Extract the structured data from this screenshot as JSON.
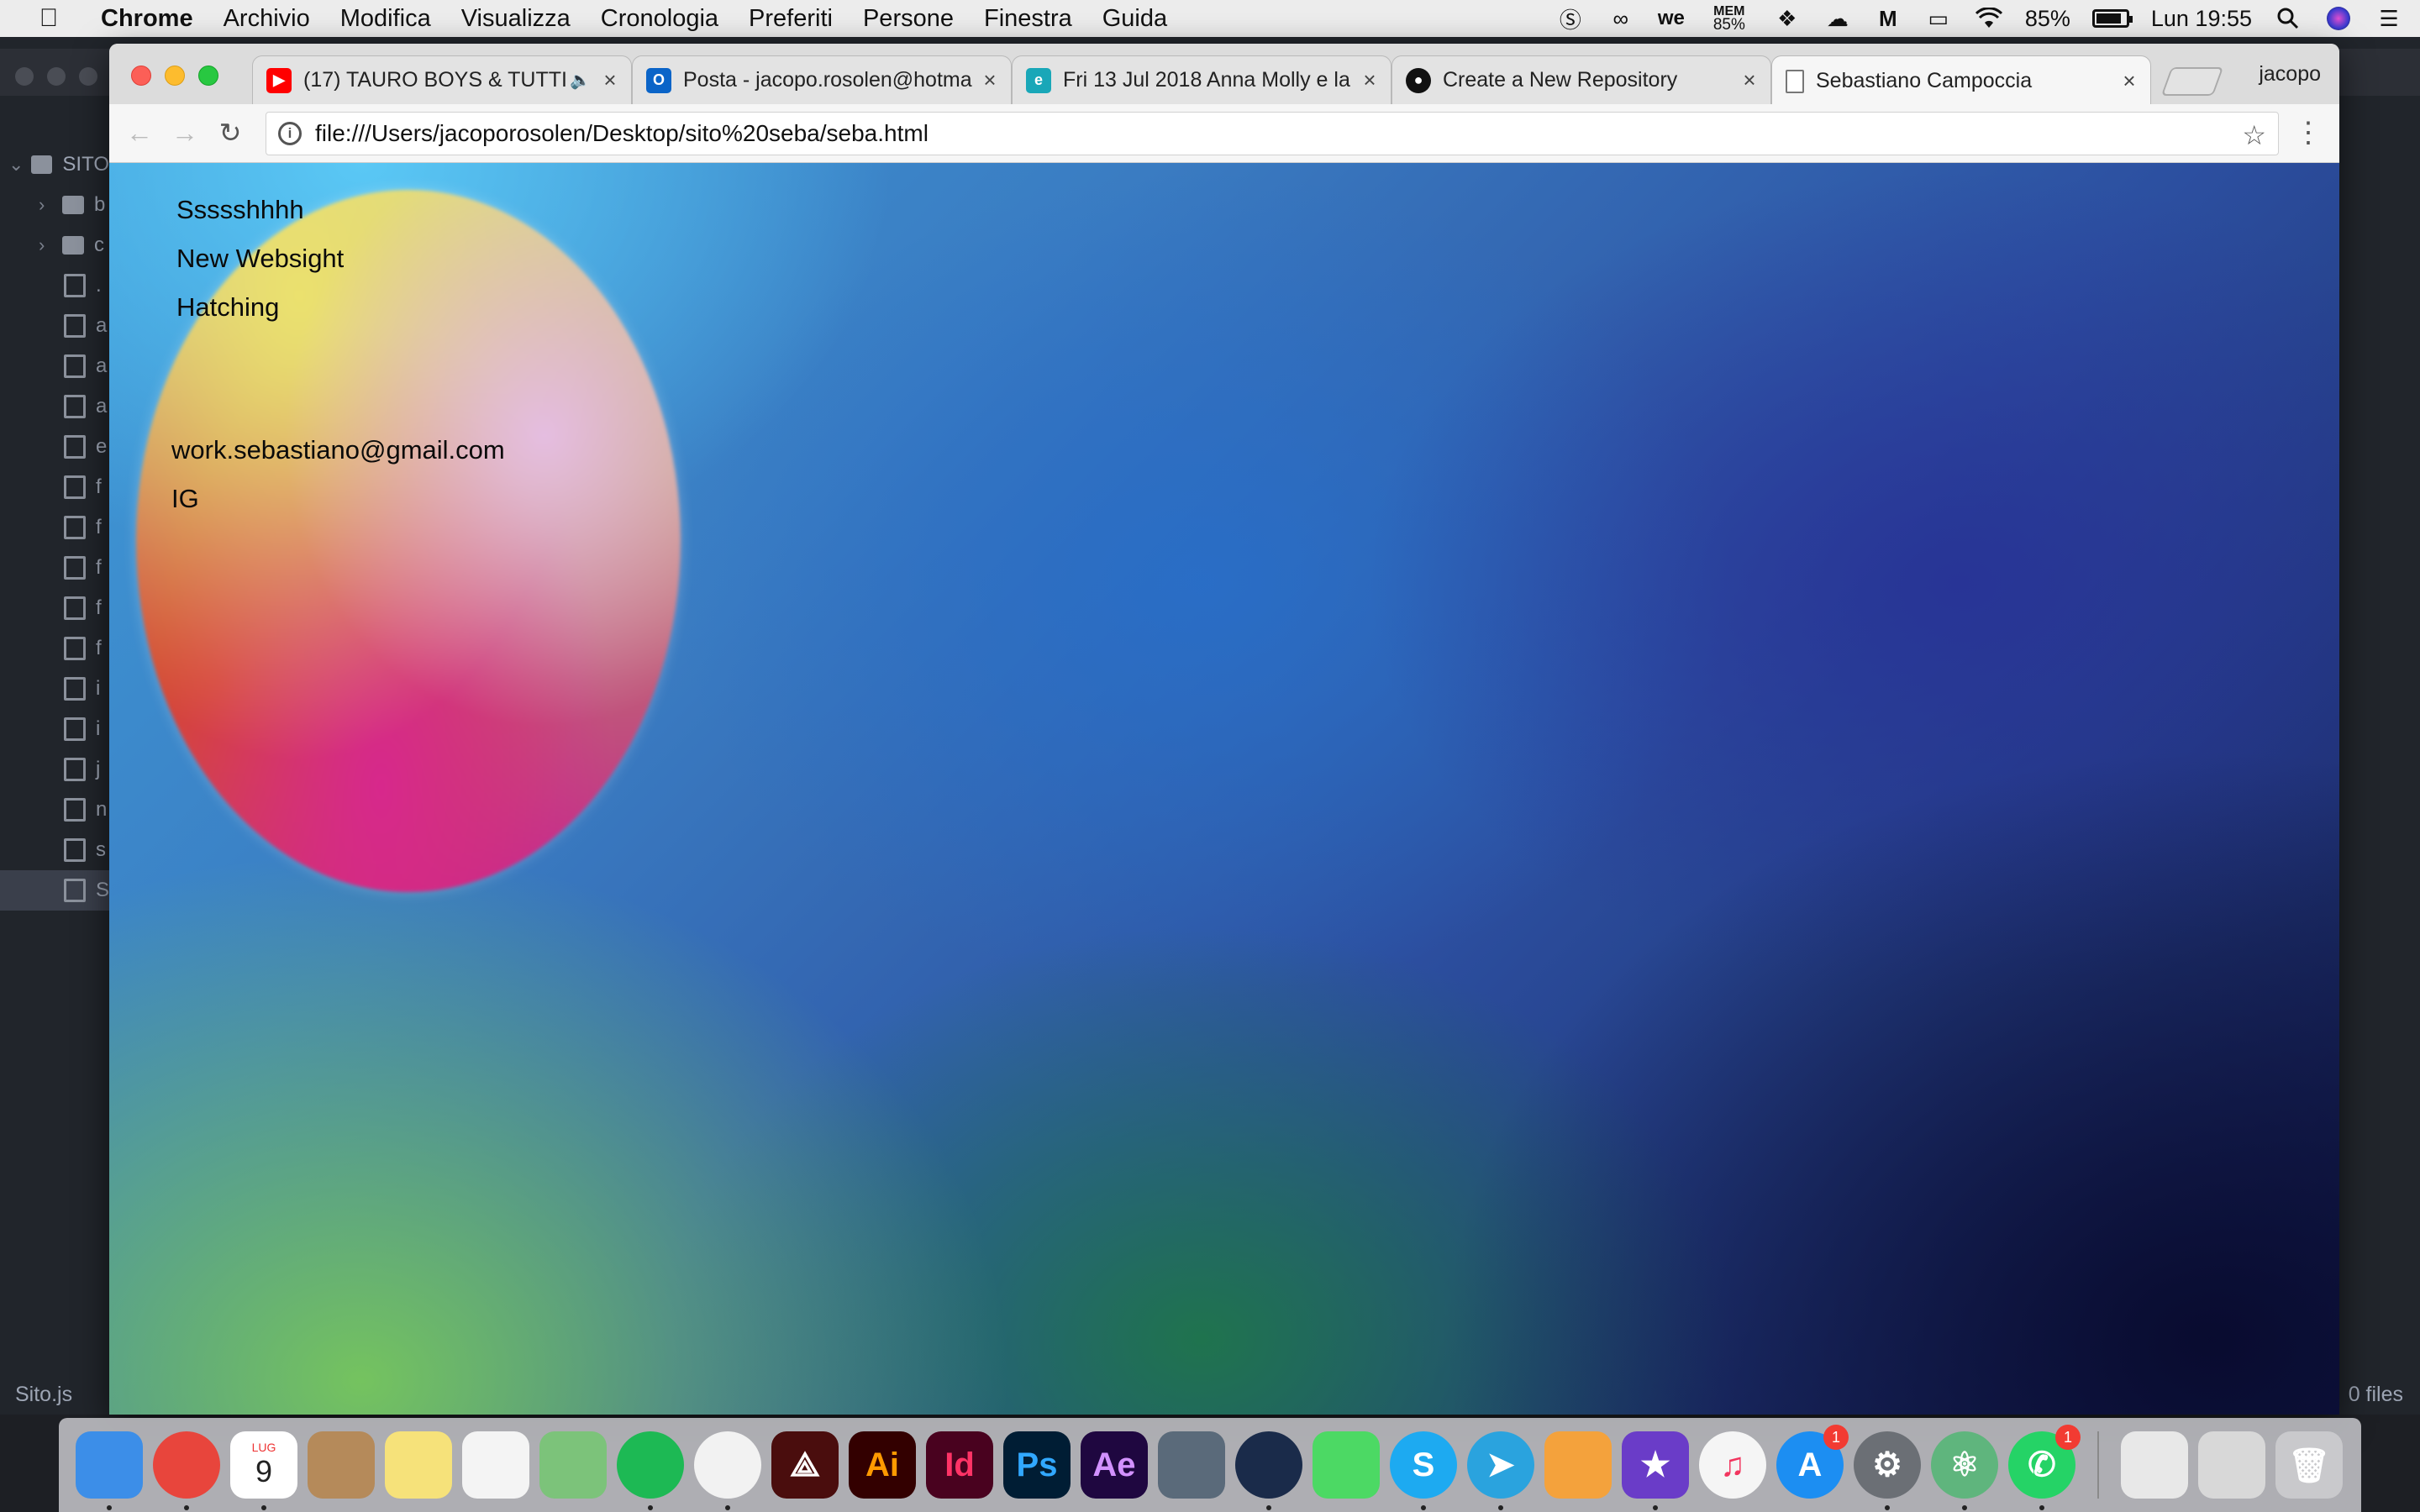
{
  "menubar": {
    "app": "Chrome",
    "menus": [
      "Archivio",
      "Modifica",
      "Visualizza",
      "Cronologia",
      "Preferiti",
      "Persone",
      "Finestra",
      "Guida"
    ],
    "mem_label": "MEM",
    "mem_value": "85%",
    "battery": "85%",
    "battery_level": 0.85,
    "clock": "Lun 19:55",
    "status_icons": [
      "skype-icon",
      "creative-cloud-icon",
      "wetransfer-icon",
      "dropbox-icon",
      "google-drive-icon",
      "gmail-icon",
      "airplay-icon",
      "wifi-icon",
      "battery-icon",
      "spotlight-icon",
      "siri-icon",
      "notification-center-icon"
    ]
  },
  "editor": {
    "project_label": "SITO",
    "tree_items": [
      {
        "type": "folder",
        "label": "b"
      },
      {
        "type": "folder",
        "label": "c"
      },
      {
        "type": "file",
        "label": "."
      },
      {
        "type": "file",
        "label": "a"
      },
      {
        "type": "file",
        "label": "a"
      },
      {
        "type": "file",
        "label": "a"
      },
      {
        "type": "image",
        "label": "e"
      },
      {
        "type": "file",
        "label": "f"
      },
      {
        "type": "file",
        "label": "f"
      },
      {
        "type": "file",
        "label": "f"
      },
      {
        "type": "file",
        "label": "f"
      },
      {
        "type": "file",
        "label": "f"
      },
      {
        "type": "file",
        "label": "i"
      },
      {
        "type": "image",
        "label": "i"
      },
      {
        "type": "file",
        "label": "j"
      },
      {
        "type": "image",
        "label": "n"
      },
      {
        "type": "file",
        "label": "s"
      },
      {
        "type": "file",
        "label": "S"
      }
    ],
    "status_left": "Sito.js",
    "status_right": "0 files"
  },
  "browser": {
    "profile": "jacopo",
    "tabs": [
      {
        "title": "(17) TAURO BOYS & TUTTI",
        "favicon": "youtube-icon",
        "color": "#ff0000",
        "glyph": "▶",
        "audio": true
      },
      {
        "title": "Posta - jacopo.rosolen@hotma",
        "favicon": "outlook-icon",
        "color": "#0a64c8",
        "glyph": "O"
      },
      {
        "title": "Fri 13 Jul 2018 Anna Molly e la",
        "favicon": "page-e-icon",
        "color": "#19a7b8",
        "glyph": "e"
      },
      {
        "title": "Create a New Repository",
        "favicon": "github-icon",
        "color": "#111111",
        "glyph": "●"
      },
      {
        "title": "Sebastiano Campoccia",
        "favicon": "document-icon",
        "color": "#ffffff",
        "glyph": "▯",
        "active": true
      }
    ],
    "url": "file:///Users/jacoporosolen/Desktop/sito%20seba/seba.html"
  },
  "site": {
    "nav": [
      "Ssssshhhh",
      "New Websight",
      "Hatching"
    ],
    "email": "work.sebastiano@gmail.com",
    "ig": "IG",
    "colors": {
      "sky": "#5ac8f5",
      "blue": "#2c4fa0",
      "navy": "#0b1040",
      "green": "#57b85a",
      "blob_yellow": "#ebe16e",
      "blob_pink": "#d7288c",
      "blob_red": "#d74628"
    }
  },
  "dock": {
    "apps": [
      {
        "name": "finder-icon",
        "label": "",
        "color": "#3c8ee8",
        "running": true
      },
      {
        "name": "chrome-icon",
        "label": "",
        "color": "#e8453c",
        "circle": true,
        "running": true
      },
      {
        "name": "calendar-icon",
        "label": "9",
        "month": "LUG",
        "color": "#ffffff",
        "running": true
      },
      {
        "name": "contacts-icon",
        "label": "",
        "color": "#b58a5a"
      },
      {
        "name": "notes-icon",
        "label": "",
        "color": "#f6e27a"
      },
      {
        "name": "reminders-icon",
        "label": "",
        "color": "#f4f4f4"
      },
      {
        "name": "maps-icon",
        "label": "",
        "color": "#7cc37a"
      },
      {
        "name": "spotify-icon",
        "label": "",
        "color": "#1db954",
        "circle": true,
        "running": true
      },
      {
        "name": "photos-icon",
        "label": "",
        "color": "#f2f2f2",
        "circle": true,
        "running": true
      },
      {
        "name": "acrobat-icon",
        "label": "⟁",
        "color": "#4a0d0d"
      },
      {
        "name": "illustrator-icon",
        "label": "Ai",
        "color": "#330000",
        "fg": "#ff9a00"
      },
      {
        "name": "indesign-icon",
        "label": "Id",
        "color": "#49021f",
        "fg": "#ff3366"
      },
      {
        "name": "photoshop-icon",
        "label": "Ps",
        "color": "#001d34",
        "fg": "#31a8ff"
      },
      {
        "name": "after-effects-icon",
        "label": "Ae",
        "color": "#1f0740",
        "fg": "#d291ff"
      },
      {
        "name": "imovie-icon",
        "label": "",
        "color": "#5a6a7a"
      },
      {
        "name": "cinema4d-icon",
        "label": "",
        "color": "#1a2b4a",
        "circle": true,
        "running": true
      },
      {
        "name": "facetime-icon",
        "label": "",
        "color": "#4cd964"
      },
      {
        "name": "skype-icon",
        "label": "S",
        "color": "#1daaf1",
        "circle": true,
        "running": true
      },
      {
        "name": "telegram-icon",
        "label": "➤",
        "color": "#2aa3de",
        "circle": true,
        "running": true
      },
      {
        "name": "pages-icon",
        "label": "",
        "color": "#f4a23c"
      },
      {
        "name": "imovie-star-icon",
        "label": "★",
        "color": "#6a3cc8",
        "running": true
      },
      {
        "name": "itunes-icon",
        "label": "♫",
        "color": "#f5f5f5",
        "fg": "#f2355e",
        "circle": true
      },
      {
        "name": "app-store-icon",
        "label": "A",
        "color": "#1c8ef2",
        "circle": true,
        "badge": "1"
      },
      {
        "name": "system-preferences-icon",
        "label": "⚙",
        "color": "#6b6f75",
        "circle": true,
        "running": true
      },
      {
        "name": "atom-icon",
        "label": "⚛",
        "color": "#5fb57d",
        "circle": true,
        "running": true
      },
      {
        "name": "whatsapp-icon",
        "label": "✆",
        "color": "#25d366",
        "circle": true,
        "badge": "1",
        "running": true
      },
      {
        "name": "downloads-stack-icon",
        "label": "",
        "color": "#e8e8e8"
      },
      {
        "name": "documents-stack-icon",
        "label": "",
        "color": "#d8d8d8"
      },
      {
        "name": "trash-icon",
        "label": "🗑",
        "color": "#c9c9cc"
      }
    ]
  }
}
